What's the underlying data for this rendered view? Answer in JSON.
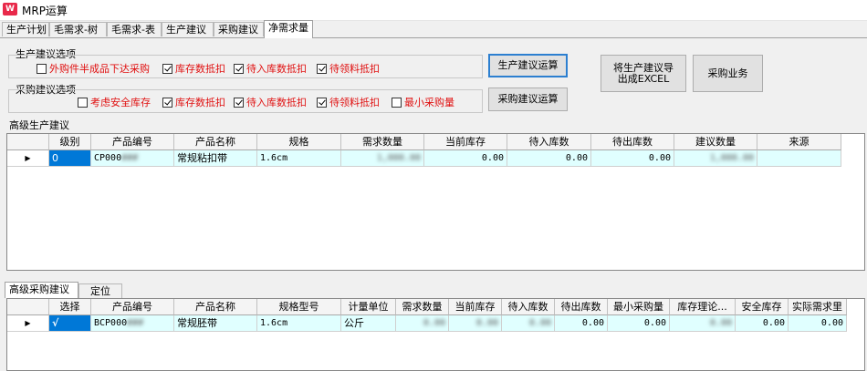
{
  "window": {
    "title": "MRP运算",
    "icon_text": "W"
  },
  "tabs": [
    "生产计划",
    "毛需求-树",
    "毛需求-表",
    "生产建议",
    "采购建议",
    "净需求量"
  ],
  "prod_options": {
    "label": "生产建议选项",
    "items": [
      {
        "label": "外购件半成品下达采购",
        "checked": false
      },
      {
        "label": "库存数抵扣",
        "checked": true
      },
      {
        "label": "待入库数抵扣",
        "checked": true
      },
      {
        "label": "待领料抵扣",
        "checked": true
      }
    ]
  },
  "purch_options": {
    "label": "采购建议选项",
    "items": [
      {
        "label": "考虑安全库存",
        "checked": false
      },
      {
        "label": "库存数抵扣",
        "checked": true
      },
      {
        "label": "待入库数抵扣",
        "checked": true
      },
      {
        "label": "待领料抵扣",
        "checked": true
      },
      {
        "label": "最小采购量",
        "checked": false
      }
    ]
  },
  "buttons": {
    "prod_calc": "生产建议运算",
    "purch_calc": "采购建议运算",
    "export": "将生产建议导出成EXCEL",
    "purch_business": "采购业务"
  },
  "prod_grid": {
    "label": "高级生产建议",
    "columns": [
      "级别",
      "产品编号",
      "产品名称",
      "规格",
      "需求数量",
      "当前库存",
      "待入库数",
      "待出库数",
      "建议数量",
      "来源"
    ],
    "rows": [
      {
        "level": "0",
        "code": "CP000",
        "code_hidden": "###",
        "name": "常规粘扣带",
        "spec": "1.6cm",
        "demand": "1,000.00",
        "stock": "0.00",
        "in": "0.00",
        "out": "0.00",
        "suggest": "1,000.00",
        "source": ""
      }
    ]
  },
  "purch_grid": {
    "tabs": [
      "高级采购建议",
      "定位"
    ],
    "columns": [
      "选择",
      "产品编号",
      "产品名称",
      "规格型号",
      "计量单位",
      "需求数量",
      "当前库存",
      "待入库数",
      "待出库数",
      "最小采购量",
      "库存理论...",
      "安全库存",
      "实际需求里"
    ],
    "rows": [
      {
        "select": "√",
        "code": "BCP000",
        "code_hidden": "###",
        "name": "常规胚带",
        "spec": "1.6cm",
        "unit": "公斤",
        "demand": "0.00",
        "stock": "0.00",
        "in": "0.00",
        "out": "0.00",
        "min": "0.00",
        "theory": "0.00",
        "safe": "0.00",
        "actual": "0.00"
      }
    ]
  },
  "row_indicator": "▶"
}
